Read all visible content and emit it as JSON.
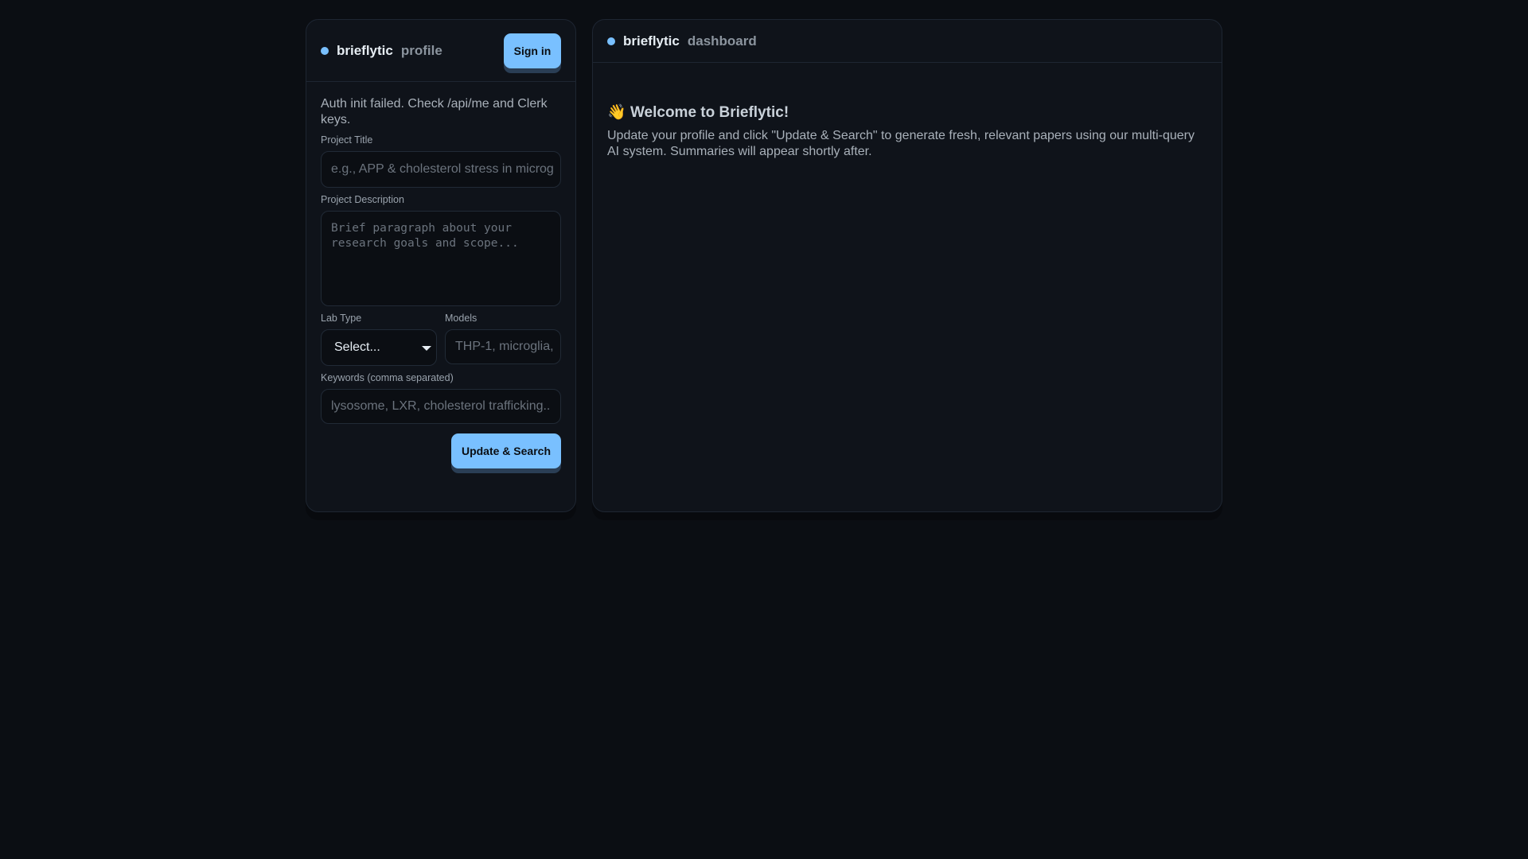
{
  "profile": {
    "brand": "brieflytic",
    "section": "profile",
    "sign_in": "Sign in",
    "error": "Auth init failed. Check /api/me and Clerk keys.",
    "fields": {
      "title_label": "Project Title",
      "title_placeholder": "e.g., APP & cholesterol stress in microg",
      "desc_label": "Project Description",
      "desc_placeholder": "Brief paragraph about your research goals and scope...",
      "lab_label": "Lab Type",
      "lab_value": "Select...",
      "models_label": "Models",
      "models_placeholder": "THP-1, microglia,",
      "keywords_label": "Keywords (comma separated)",
      "keywords_placeholder": "lysosome, LXR, cholesterol trafficking.."
    },
    "submit": "Update & Search"
  },
  "dashboard": {
    "brand": "brieflytic",
    "section": "dashboard",
    "emoji": "👋",
    "welcome": "Welcome to Brieflytic!",
    "description": "Update your profile and click \"Update & Search\" to generate fresh, relevant papers using our multi-query AI system. Summaries will appear shortly after."
  },
  "colors": {
    "accent": "#79c0ff",
    "bg": "#0b0e13",
    "panel": "#0f131a"
  }
}
